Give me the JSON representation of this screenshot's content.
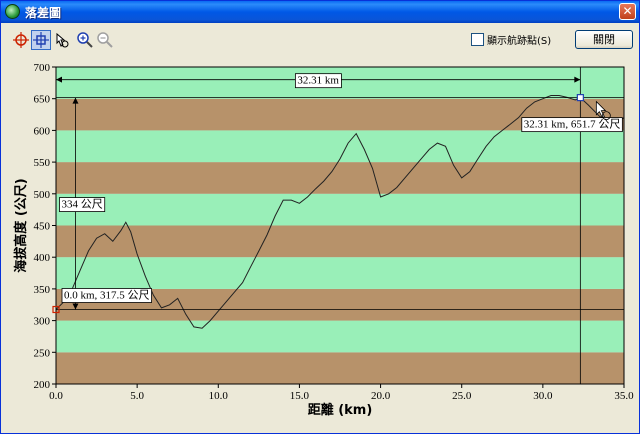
{
  "window": {
    "title": "落差圖"
  },
  "toolbar": {
    "buttons": [
      {
        "id": "select",
        "icon": "crosshair-icon",
        "color": "#cc2200"
      },
      {
        "id": "measure",
        "icon": "crosshair-target-icon",
        "color": "#1f3fb0"
      },
      {
        "id": "pan",
        "icon": "hand-pointer-icon"
      },
      {
        "id": "zoom-in",
        "icon": "zoom-in-icon"
      },
      {
        "id": "zoom-out",
        "icon": "zoom-out-icon"
      }
    ],
    "checkbox_label": "顯示航跡點(S)",
    "checkbox_checked": false,
    "close_label": "關閉"
  },
  "chart_data": {
    "type": "area",
    "xlabel": "距離 (km)",
    "ylabel": "海拔高度 (公尺)",
    "xlim": [
      0,
      35
    ],
    "ylim": [
      200,
      700
    ],
    "xticks": [
      "0.0",
      "5.0",
      "10.0",
      "15.0",
      "20.0",
      "25.0",
      "30.0",
      "35.0"
    ],
    "yticks": [
      "200",
      "250",
      "300",
      "350",
      "400",
      "450",
      "500",
      "550",
      "600",
      "650",
      "700"
    ],
    "colors": {
      "plot_bg": "#d5fafd",
      "band_dark": "#b7926a",
      "band_light": "#99efb8",
      "marker": "#1f3fb0"
    },
    "series": [
      {
        "x": [
          0,
          0.5,
          1,
          1.5,
          2,
          2.5,
          3,
          3.5,
          4,
          4.3,
          4.6,
          5,
          5.5,
          6,
          6.5,
          7,
          7.5,
          8,
          8.5,
          9,
          9.5,
          10,
          10.5,
          11,
          11.5,
          12,
          12.5,
          13,
          13.5,
          14,
          14.5,
          15,
          15.5,
          16,
          16.5,
          17,
          17.5,
          18,
          18.5,
          19,
          19.5,
          20,
          20.5,
          21,
          21.5,
          22,
          22.5,
          23,
          23.5,
          24,
          24.5,
          25,
          25.5,
          26,
          26.5,
          27,
          27.5,
          28,
          28.5,
          29,
          29.5,
          30,
          30.5,
          31,
          31.5,
          32,
          32.31,
          32.8,
          33.5,
          34,
          34.5,
          35
        ],
        "y": [
          317.5,
          330,
          350,
          380,
          410,
          430,
          437,
          425,
          442,
          455,
          440,
          405,
          370,
          340,
          320,
          325,
          335,
          310,
          290,
          288,
          300,
          315,
          330,
          345,
          360,
          385,
          410,
          435,
          465,
          490,
          490,
          485,
          495,
          508,
          520,
          535,
          555,
          580,
          595,
          570,
          540,
          495,
          500,
          510,
          525,
          540,
          555,
          570,
          580,
          575,
          545,
          525,
          535,
          555,
          575,
          590,
          600,
          610,
          620,
          635,
          645,
          650,
          655,
          655,
          652,
          648,
          651.7,
          640,
          622,
          615,
          612,
          620
        ]
      }
    ],
    "annotations": {
      "distance_label": "32.31 km",
      "start_label": "0.0 km, 317.5 公尺",
      "end_label": "32.31 km, 651.7 公尺",
      "difference_label": "334 公尺",
      "start": {
        "x": 0,
        "y": 317.5
      },
      "end": {
        "x": 32.31,
        "y": 651.7
      }
    }
  }
}
